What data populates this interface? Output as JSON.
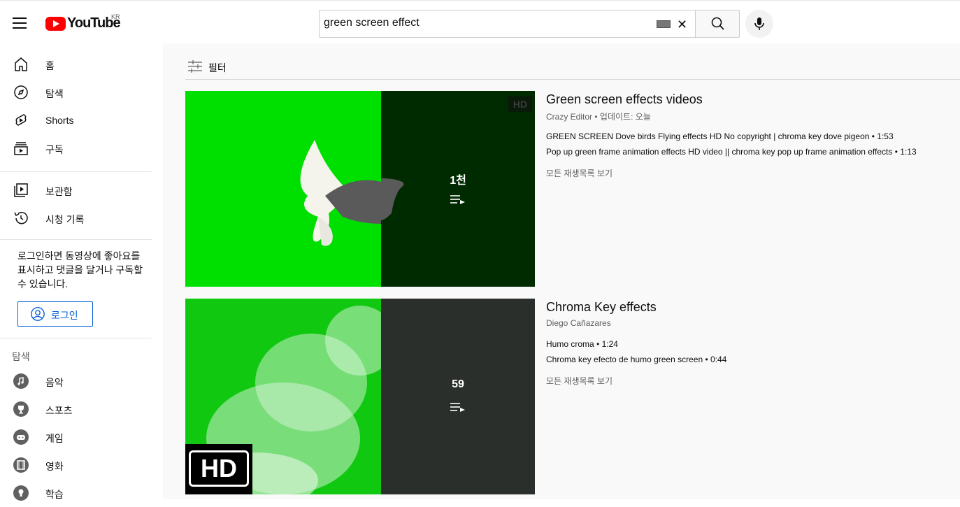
{
  "header": {
    "logo_text": "YouTube",
    "region": "KR",
    "search_value": "green screen effect",
    "icons": [
      "menu-icon",
      "keyboard-icon",
      "close-icon",
      "search-icon",
      "mic-icon"
    ]
  },
  "sidebar": {
    "main_items": [
      {
        "label": "홈",
        "icon": "home-icon"
      },
      {
        "label": "탐색",
        "icon": "compass-icon"
      },
      {
        "label": "Shorts",
        "icon": "shorts-icon"
      },
      {
        "label": "구독",
        "icon": "subscriptions-icon"
      }
    ],
    "library_items": [
      {
        "label": "보관함",
        "icon": "library-icon"
      },
      {
        "label": "시청 기록",
        "icon": "history-icon"
      }
    ],
    "login_prompt": "로그인하면 동영상에 좋아요를 표시하고 댓글을 달거나 구독할 수 있습니다.",
    "login_button": "로그인",
    "explore_header": "탐색",
    "explore_items": [
      {
        "label": "음악",
        "icon": "music-icon"
      },
      {
        "label": "스포츠",
        "icon": "trophy-icon"
      },
      {
        "label": "게임",
        "icon": "gamepad-icon"
      },
      {
        "label": "영화",
        "icon": "film-icon"
      },
      {
        "label": "학습",
        "icon": "lightbulb-icon"
      }
    ]
  },
  "main": {
    "filter_label": "필터",
    "results": [
      {
        "title": "Green screen effects videos",
        "channel": "Crazy Editor",
        "meta": "업데이트: 오늘",
        "count": "1천",
        "badge": "HD",
        "videos": [
          {
            "title": "GREEN SCREEN Dove birds Flying effects HD No copyright | chroma key dove pigeon",
            "duration": "1:53"
          },
          {
            "title": "Pop up green frame animation effects HD video || chroma key pop up frame animation effects",
            "duration": "1:13"
          }
        ],
        "view_all": "모든 재생목록 보기",
        "colors": {
          "left": "#00e000",
          "right": "#002a00"
        }
      },
      {
        "title": "Chroma Key effects",
        "channel": "Diego Cañazares",
        "meta": "",
        "count": "59",
        "badge": "HD",
        "videos": [
          {
            "title": "Humo croma",
            "duration": "1:24"
          },
          {
            "title": "Chroma key efecto de humo green screen",
            "duration": "0:44"
          }
        ],
        "view_all": "모든 재생목록 보기",
        "colors": {
          "left": "#10c810",
          "right": "#2b2f2b"
        }
      }
    ]
  }
}
